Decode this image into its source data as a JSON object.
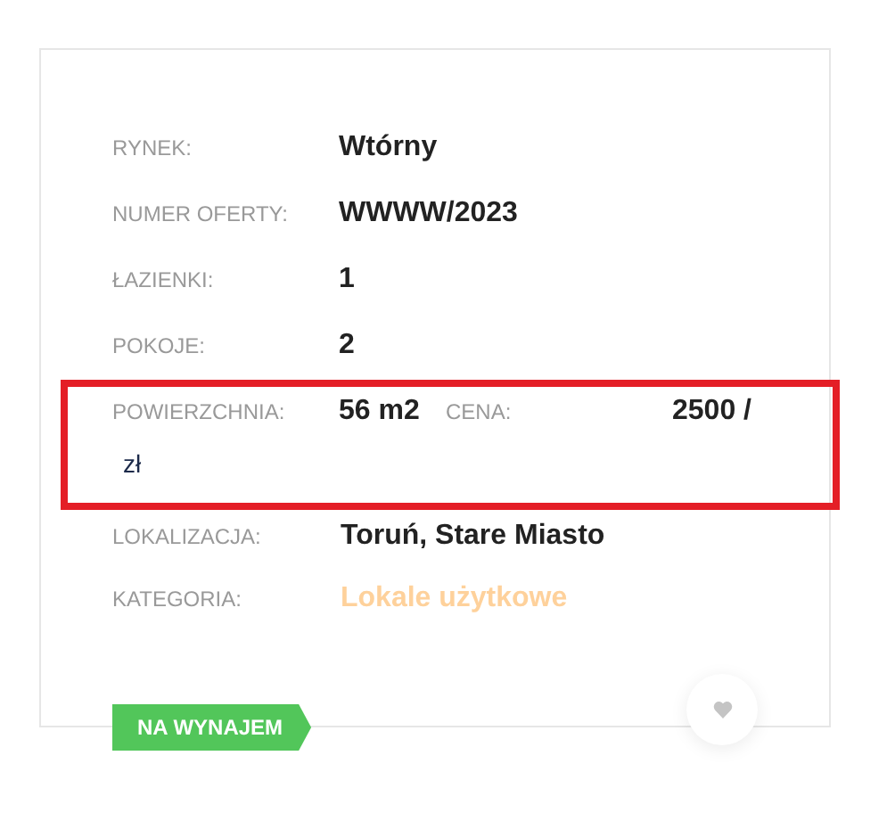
{
  "details": [
    {
      "kind": "single",
      "label": "RYNEK:",
      "value": "Wtórny",
      "link": false,
      "highlighted": false
    },
    {
      "kind": "single",
      "label": "NUMER OFERTY:",
      "value": "WWWW/2023",
      "link": false,
      "highlighted": false
    },
    {
      "kind": "single",
      "label": "ŁAZIENKI:",
      "value": "1",
      "link": false,
      "highlighted": false
    },
    {
      "kind": "single",
      "label": "POKOJE:",
      "value": "2",
      "link": false,
      "highlighted": false
    },
    {
      "kind": "pair",
      "label": "POWIERZCHNIA:",
      "value": "56 m2",
      "label_2": "CENA:",
      "value_2": "2500 /",
      "unit": "zł",
      "highlighted": true
    },
    {
      "kind": "single",
      "label": "LOKALIZACJA:",
      "value": "Toruń, Stare Miasto",
      "link": false,
      "highlighted": false
    },
    {
      "kind": "single",
      "label": "KATEGORIA:",
      "value": "Lokale użytkowe",
      "link": true,
      "highlighted": false
    }
  ],
  "tag": "NA WYNAJEM",
  "favorite": {
    "selected": false
  }
}
